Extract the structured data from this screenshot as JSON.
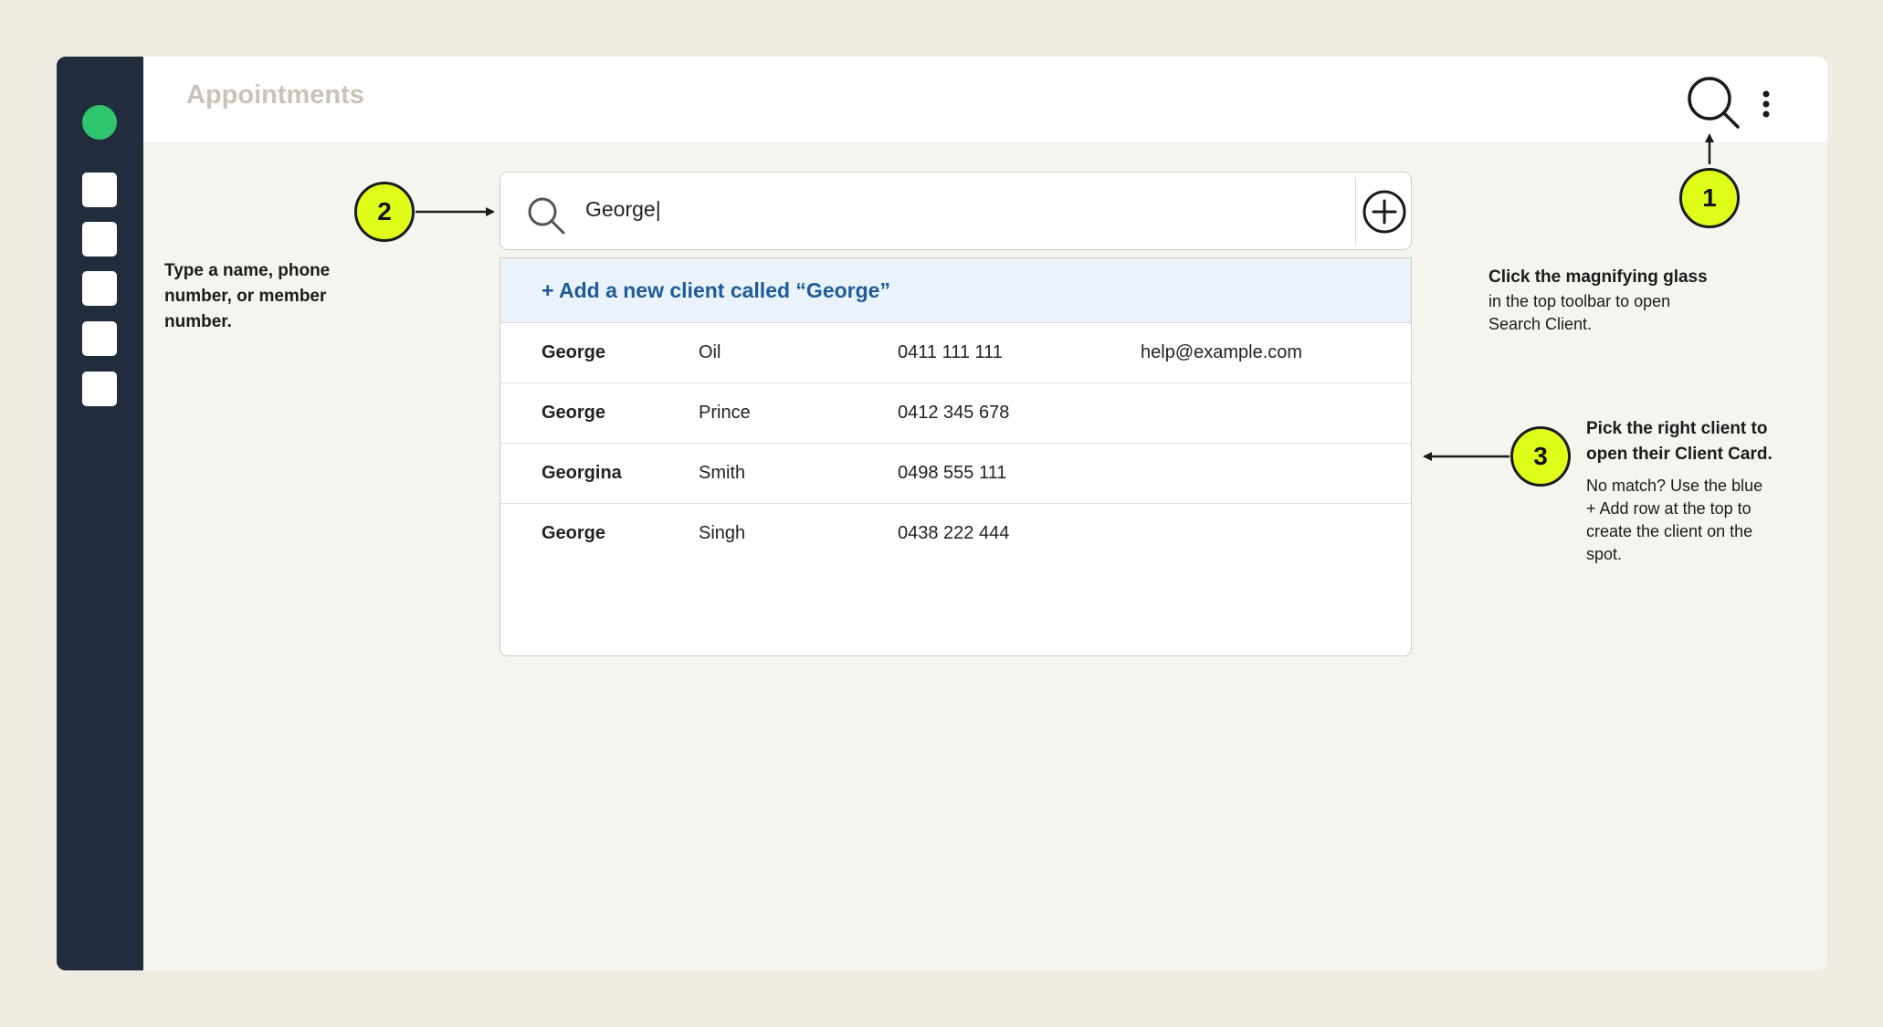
{
  "app": {
    "title": "Appointments"
  },
  "search": {
    "query": "George|"
  },
  "add_new_client": "+ Add a new client called “George”",
  "results": [
    {
      "first": "George",
      "last": "Oil",
      "phone": "0411 111 111",
      "email": "help@example.com"
    },
    {
      "first": "George",
      "last": "Prince",
      "phone": "0412 345 678",
      "email": ""
    },
    {
      "first": "Georgina",
      "last": "Smith",
      "phone": "0498 555 111",
      "email": ""
    },
    {
      "first": "George",
      "last": "Singh",
      "phone": "0438 222 444",
      "email": ""
    }
  ],
  "callouts": {
    "step1": {
      "number": "1",
      "heading": "Click the magnifying glass",
      "lines": [
        "in the top toolbar to open",
        "Search Client."
      ]
    },
    "step2": {
      "number": "2",
      "lines": [
        "Type a name, phone",
        "number, or member",
        "number."
      ]
    },
    "step3": {
      "number": "3",
      "heading_lines": [
        "Pick the right client to",
        "open their Client Card."
      ],
      "lines": [
        "No match? Use the blue",
        "+ Add row at the top to",
        "create the client on the",
        "spot."
      ]
    }
  },
  "colors": {
    "background": "#f0ece2",
    "sidebar": "#212d3d",
    "status_dot": "#2fc56f",
    "marker": "#dfff1a",
    "link": "#1e5b9c",
    "add_row_bg": "#eaf3fb"
  },
  "icons": [
    "search-icon",
    "more-vertical-icon",
    "plus-circle-icon"
  ]
}
